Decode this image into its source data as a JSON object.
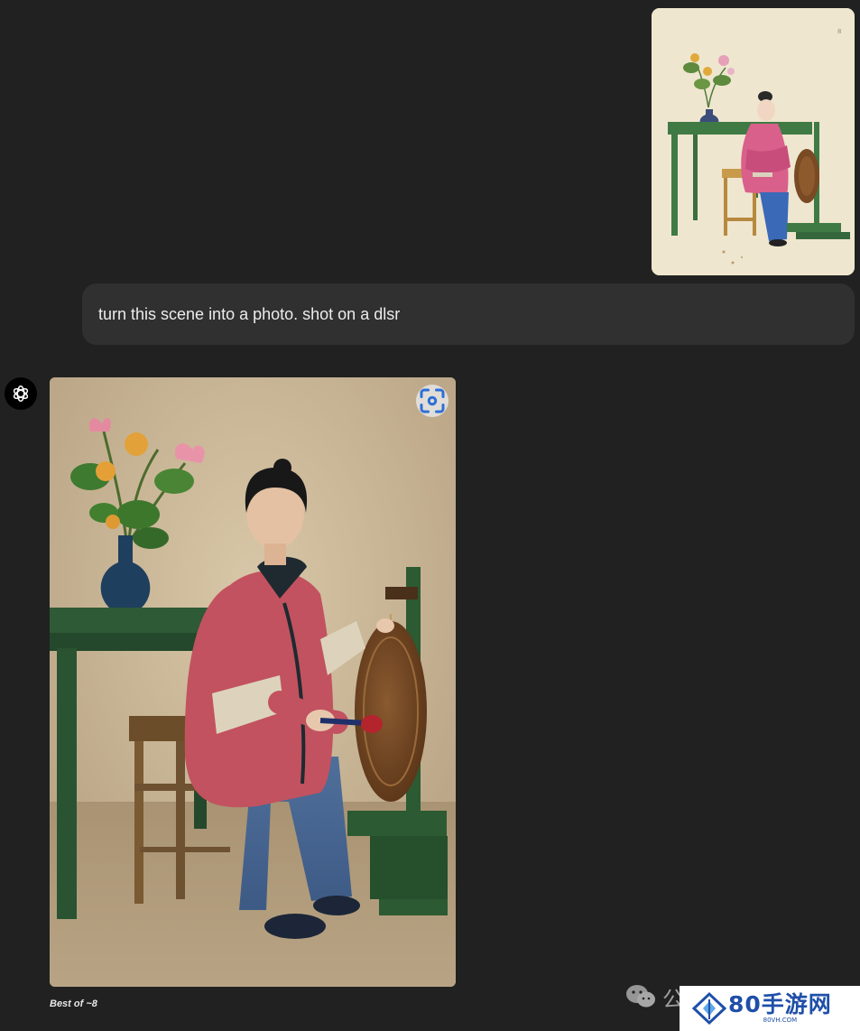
{
  "conversation": {
    "user_message": {
      "attachment": {
        "kind": "painting",
        "subject": "seated woman in pink robe striking a gong beside a green table with a blue flower vase",
        "page_mark": "8"
      },
      "text": "turn this scene into a photo. shot on a dlsr"
    },
    "assistant_message": {
      "avatar_icon": "openai-logo-icon",
      "generated_image": {
        "subject": "photo of a woman in pink jacket and denim trousers striking a bronze gong beside a green table with lotus flowers in a blue vase",
        "action_icon": "select-region-icon"
      },
      "caption": "Best of ~8"
    }
  },
  "watermarks": {
    "wechat_text": "公",
    "site_logo_text": "80手游网",
    "site_logo_sub": "80VH.COM"
  },
  "colors": {
    "background": "#212121",
    "bubble": "#303030",
    "text": "#ececec",
    "logo_blue": "#1f4fa8"
  }
}
